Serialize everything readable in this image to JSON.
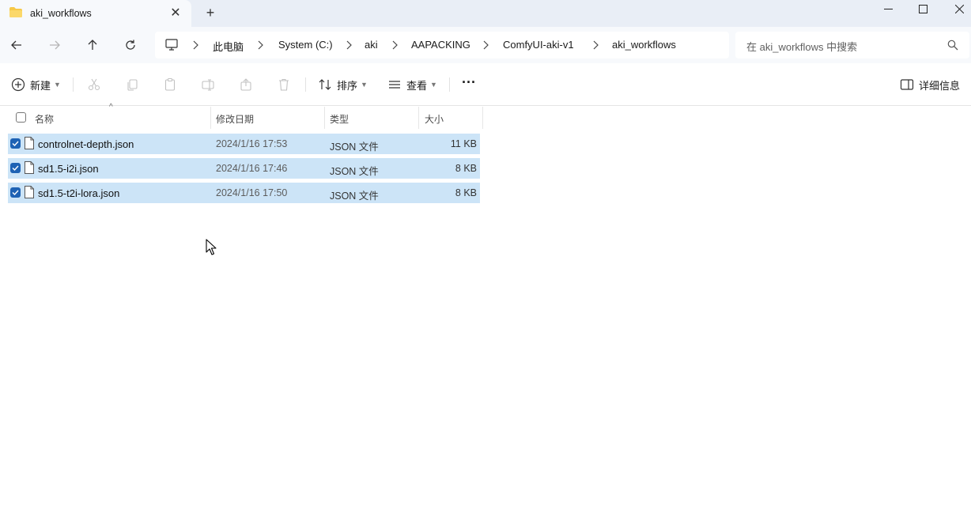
{
  "window": {
    "tab_title": "aki_workflows",
    "tab_close": "✕",
    "new_tab": "+"
  },
  "nav": {
    "breadcrumbs": [
      "此电脑",
      "System (C:)",
      "aki",
      "AAPACKING",
      "ComfyUI-aki-v1",
      "aki_workflows"
    ],
    "search_placeholder": "在 aki_workflows 中搜索"
  },
  "commands": {
    "new_label": "新建",
    "sort_label": "排序",
    "view_label": "查看",
    "more_label": "···",
    "details_label": "详细信息"
  },
  "columns": {
    "name": "名称",
    "date": "修改日期",
    "type": "类型",
    "size": "大小"
  },
  "files": [
    {
      "name": "controlnet-depth.json",
      "date": "2024/1/16 17:53",
      "type": "JSON 文件",
      "size": "11 KB",
      "selected": true
    },
    {
      "name": "sd1.5-i2i.json",
      "date": "2024/1/16 17:46",
      "type": "JSON 文件",
      "size": "8 KB",
      "selected": true
    },
    {
      "name": "sd1.5-t2i-lora.json",
      "date": "2024/1/16 17:50",
      "type": "JSON 文件",
      "size": "8 KB",
      "selected": true
    }
  ],
  "colors": {
    "selection": "#cce4f7",
    "checkbox": "#1e62b4",
    "folder": "#f7c948",
    "chrome": "#e9eef6"
  }
}
